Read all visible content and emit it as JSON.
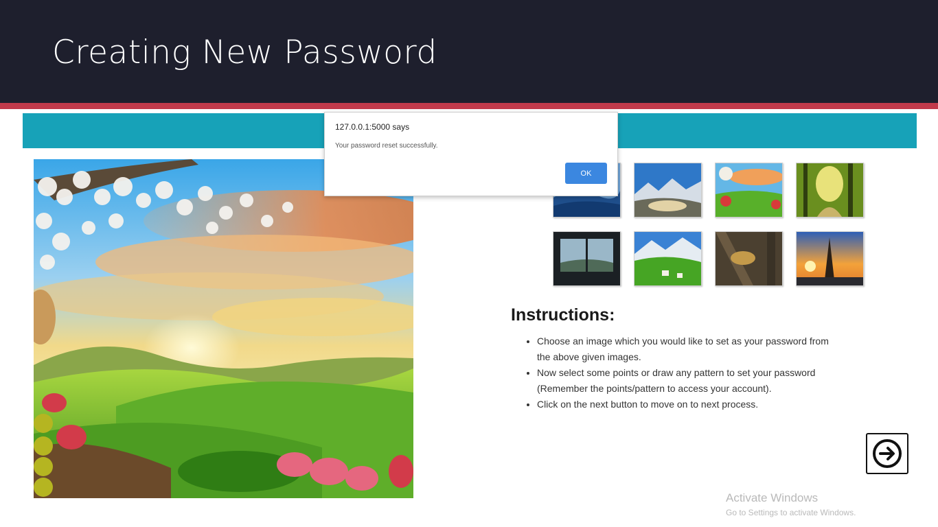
{
  "slide": {
    "title": "Creating New Password"
  },
  "dialog": {
    "origin": "127.0.0.1:5000 says",
    "message": "Your password reset successfully.",
    "ok_label": "OK"
  },
  "instructions": {
    "heading": "Instructions:",
    "items": [
      "Choose an image which you would like to set as your password from the above given images.",
      "Now select some points or draw any pattern to set your password (Remember the points/pattern to access your account).",
      "Click on the next button to move on to next process."
    ]
  },
  "thumbnails": [
    {
      "icon": "blue-mountains-image"
    },
    {
      "icon": "mountain-valley-image"
    },
    {
      "icon": "sunset-meadow-image"
    },
    {
      "icon": "forest-path-image"
    },
    {
      "icon": "window-view-image"
    },
    {
      "icon": "alpine-village-image"
    },
    {
      "icon": "leopard-tree-image"
    },
    {
      "icon": "eiffel-tower-sunset-image"
    }
  ],
  "watermark": {
    "line1": "Activate Windows",
    "line2": "Go to Settings to activate Windows."
  },
  "colors": {
    "header_bg": "#1e1f2d",
    "accent": "#c13a4b",
    "app_bar": "#17a2b8",
    "ok_button": "#3b87e0"
  }
}
